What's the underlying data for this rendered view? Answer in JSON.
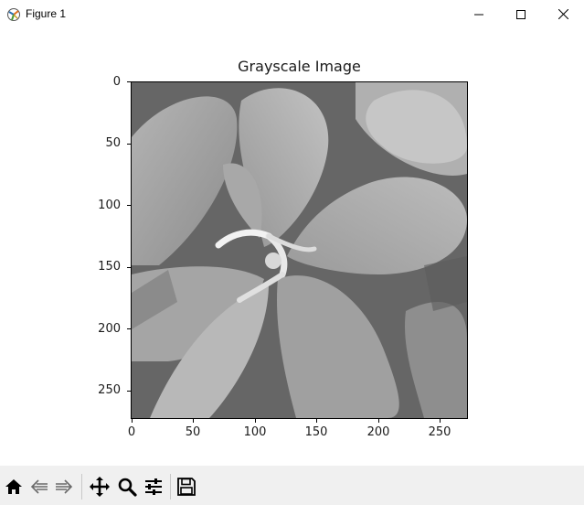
{
  "window": {
    "title": "Figure 1",
    "buttons": {
      "minimize": "minimize-icon",
      "maximize": "maximize-icon",
      "close": "close-icon"
    }
  },
  "plot": {
    "title": "Grayscale Image",
    "chart_data": {
      "type": "heatmap",
      "title": "Grayscale Image",
      "colormap": "gray",
      "image_shape": [
        273,
        273
      ],
      "xlim": [
        0,
        273
      ],
      "ylim": [
        273,
        0
      ],
      "x_ticks": [
        "0",
        "50",
        "100",
        "150",
        "200",
        "250"
      ],
      "y_ticks": [
        "0",
        "50",
        "100",
        "150",
        "200",
        "250"
      ],
      "grid": false
    }
  },
  "toolbar": {
    "items": [
      {
        "name": "home-icon"
      },
      {
        "name": "back-icon"
      },
      {
        "name": "forward-icon"
      },
      {
        "name": "pan-icon"
      },
      {
        "name": "zoom-icon"
      },
      {
        "name": "configure-subplots-icon"
      },
      {
        "name": "save-icon"
      }
    ]
  }
}
